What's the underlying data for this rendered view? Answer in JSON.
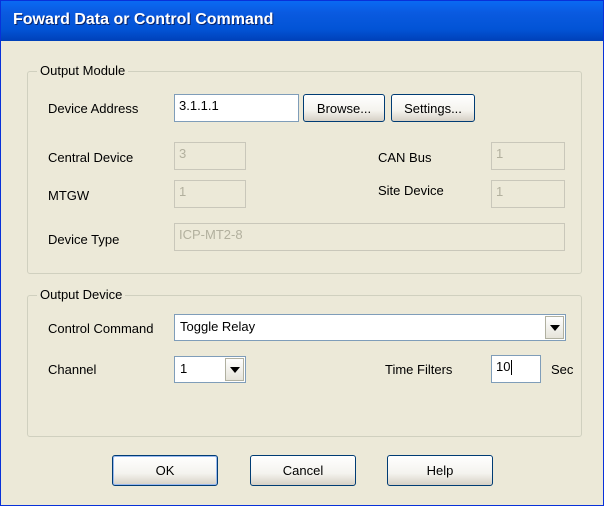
{
  "window": {
    "title": "Foward Data or Control Command"
  },
  "output_module": {
    "legend": "Output Module",
    "device_address_label": "Device Address",
    "device_address_value": "3.1.1.1",
    "browse_label": "Browse...",
    "settings_label": "Settings...",
    "central_device_label": "Central Device",
    "central_device_value": "3",
    "can_bus_label": "CAN Bus",
    "can_bus_value": "1",
    "mtgw_label": "MTGW",
    "mtgw_value": "1",
    "site_device_label": "Site Device",
    "site_device_value": "1",
    "device_type_label": "Device Type",
    "device_type_value": "ICP-MT2-8"
  },
  "output_device": {
    "legend": "Output Device",
    "control_command_label": "Control Command",
    "control_command_value": "Toggle Relay",
    "channel_label": "Channel",
    "channel_value": "1",
    "time_filters_label": "Time Filters",
    "time_filters_value": "10",
    "time_unit": "Sec"
  },
  "buttons": {
    "ok": "OK",
    "cancel": "Cancel",
    "help": "Help"
  },
  "icons": {
    "dropdown": "chevron-down-icon"
  }
}
